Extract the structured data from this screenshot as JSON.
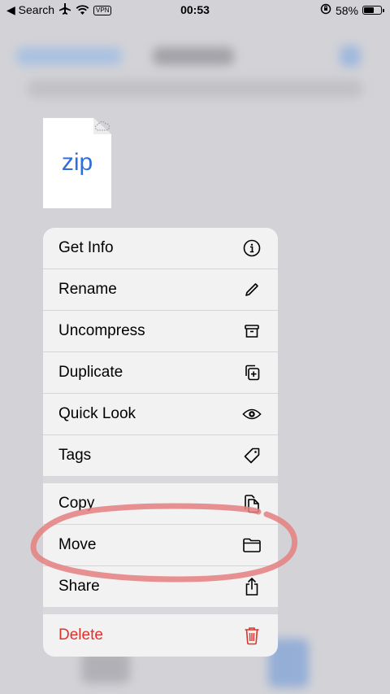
{
  "status_bar": {
    "back_label": "◀ Search",
    "time": "00:53",
    "vpn": "VPN",
    "battery": "58%",
    "battery_level": 0.58
  },
  "file": {
    "extension": "zip"
  },
  "menu": {
    "items": [
      {
        "label": "Get Info",
        "icon": "info-icon"
      },
      {
        "label": "Rename",
        "icon": "pencil-icon"
      },
      {
        "label": "Uncompress",
        "icon": "archive-box-icon"
      },
      {
        "label": "Duplicate",
        "icon": "duplicate-icon"
      },
      {
        "label": "Quick Look",
        "icon": "eye-icon"
      },
      {
        "label": "Tags",
        "icon": "tag-icon"
      },
      {
        "label": "Copy",
        "icon": "copy-docs-icon"
      },
      {
        "label": "Move",
        "icon": "folder-icon"
      },
      {
        "label": "Share",
        "icon": "share-icon"
      },
      {
        "label": "Delete",
        "icon": "trash-icon"
      }
    ]
  },
  "colors": {
    "accent_blue": "#2f6fdc",
    "destructive_red": "#e0312a",
    "highlight_scribble": "#e57f7f"
  }
}
